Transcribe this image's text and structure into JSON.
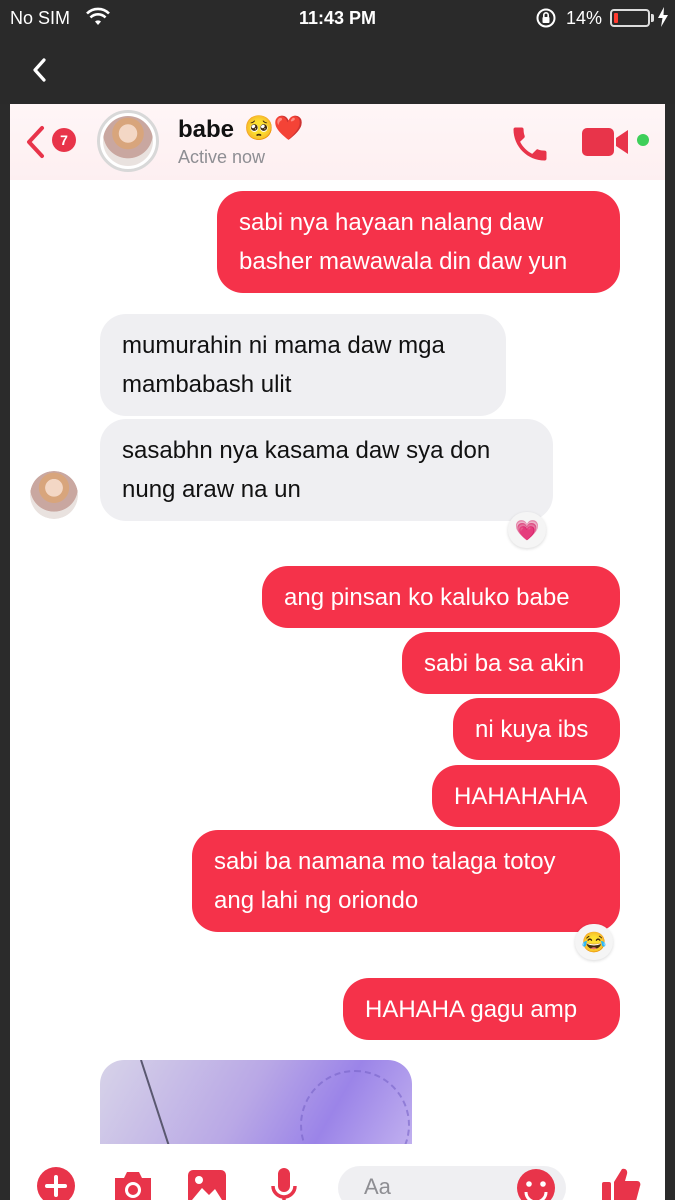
{
  "status_bar": {
    "carrier": "No SIM",
    "time": "11:43 PM",
    "battery_percent": "14%",
    "battery_level": 0.14
  },
  "chat": {
    "unread_count": "7",
    "contact_name": "babe",
    "name_emojis": "🥺❤️",
    "status": "Active now",
    "accent_color": "#f5324a"
  },
  "messages": [
    {
      "side": "sent",
      "text": [
        "sabi nya hayaan nalang daw",
        "basher mawawala din daw yun"
      ]
    },
    {
      "side": "received",
      "text": [
        "mumurahin ni mama daw mga",
        "mambabash ulit"
      ]
    },
    {
      "side": "received",
      "text": [
        "sasabhn nya kasama daw sya don",
        "nung araw na un"
      ],
      "reaction": "💗"
    },
    {
      "side": "sent",
      "text": [
        "ang pinsan ko kaluko babe"
      ]
    },
    {
      "side": "sent",
      "text": [
        "sabi ba sa akin"
      ]
    },
    {
      "side": "sent",
      "text": [
        "ni kuya ibs"
      ]
    },
    {
      "side": "sent",
      "text": [
        "HAHAHAHA"
      ]
    },
    {
      "side": "sent",
      "text": [
        "sabi ba namana mo talaga totoy",
        "ang lahi ng oriondo"
      ],
      "reaction": "😂"
    },
    {
      "side": "sent",
      "text": [
        "HAHAHA gagu amp"
      ]
    }
  ],
  "composer": {
    "placeholder": "Aa"
  },
  "icons": [
    "wifi-icon",
    "lock-rotation-icon",
    "charging-icon",
    "back-icon",
    "phone-icon",
    "video-icon",
    "plus-icon",
    "camera-icon",
    "gallery-icon",
    "mic-icon",
    "emoji-icon",
    "thumbs-up-icon"
  ]
}
